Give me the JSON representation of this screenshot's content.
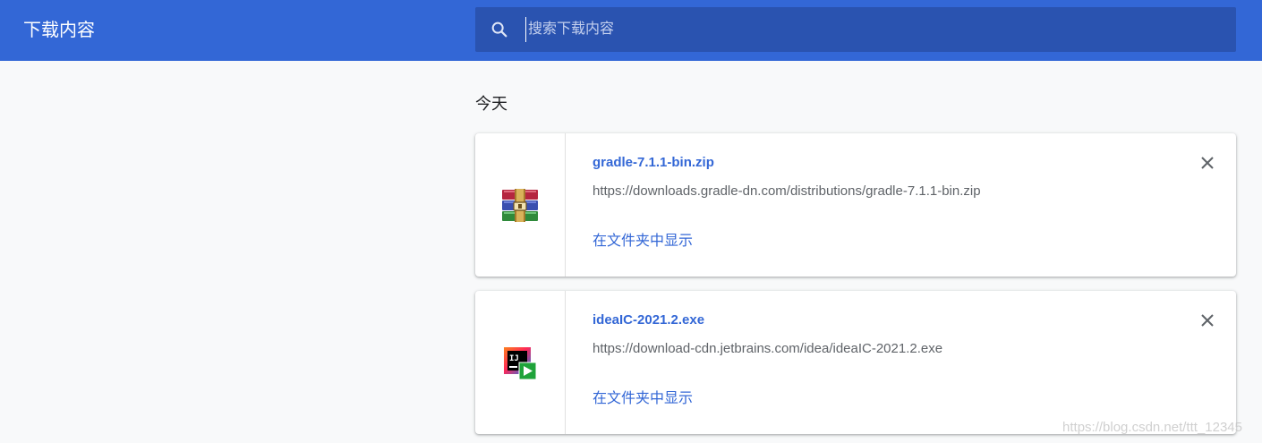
{
  "header": {
    "title": "下载内容"
  },
  "search": {
    "placeholder": "搜索下载内容",
    "value": ""
  },
  "section": {
    "heading": "今天"
  },
  "downloads": [
    {
      "file_name": "gradle-7.1.1-bin.zip",
      "url": "https://downloads.gradle-dn.com/distributions/gradle-7.1.1-bin.zip",
      "action_label": "在文件夹中显示",
      "icon": "winrar-archive-icon"
    },
    {
      "file_name": "ideaIC-2021.2.exe",
      "url": "https://download-cdn.jetbrains.com/idea/ideaIC-2021.2.exe",
      "action_label": "在文件夹中显示",
      "icon": "intellij-idea-installer-icon"
    }
  ],
  "watermark": "https://blog.csdn.net/ttt_12345",
  "colors": {
    "toolbar": "#3367d6",
    "search_background": "#2a53b0",
    "link": "#3367d6",
    "page_background": "#f8f9fa"
  }
}
